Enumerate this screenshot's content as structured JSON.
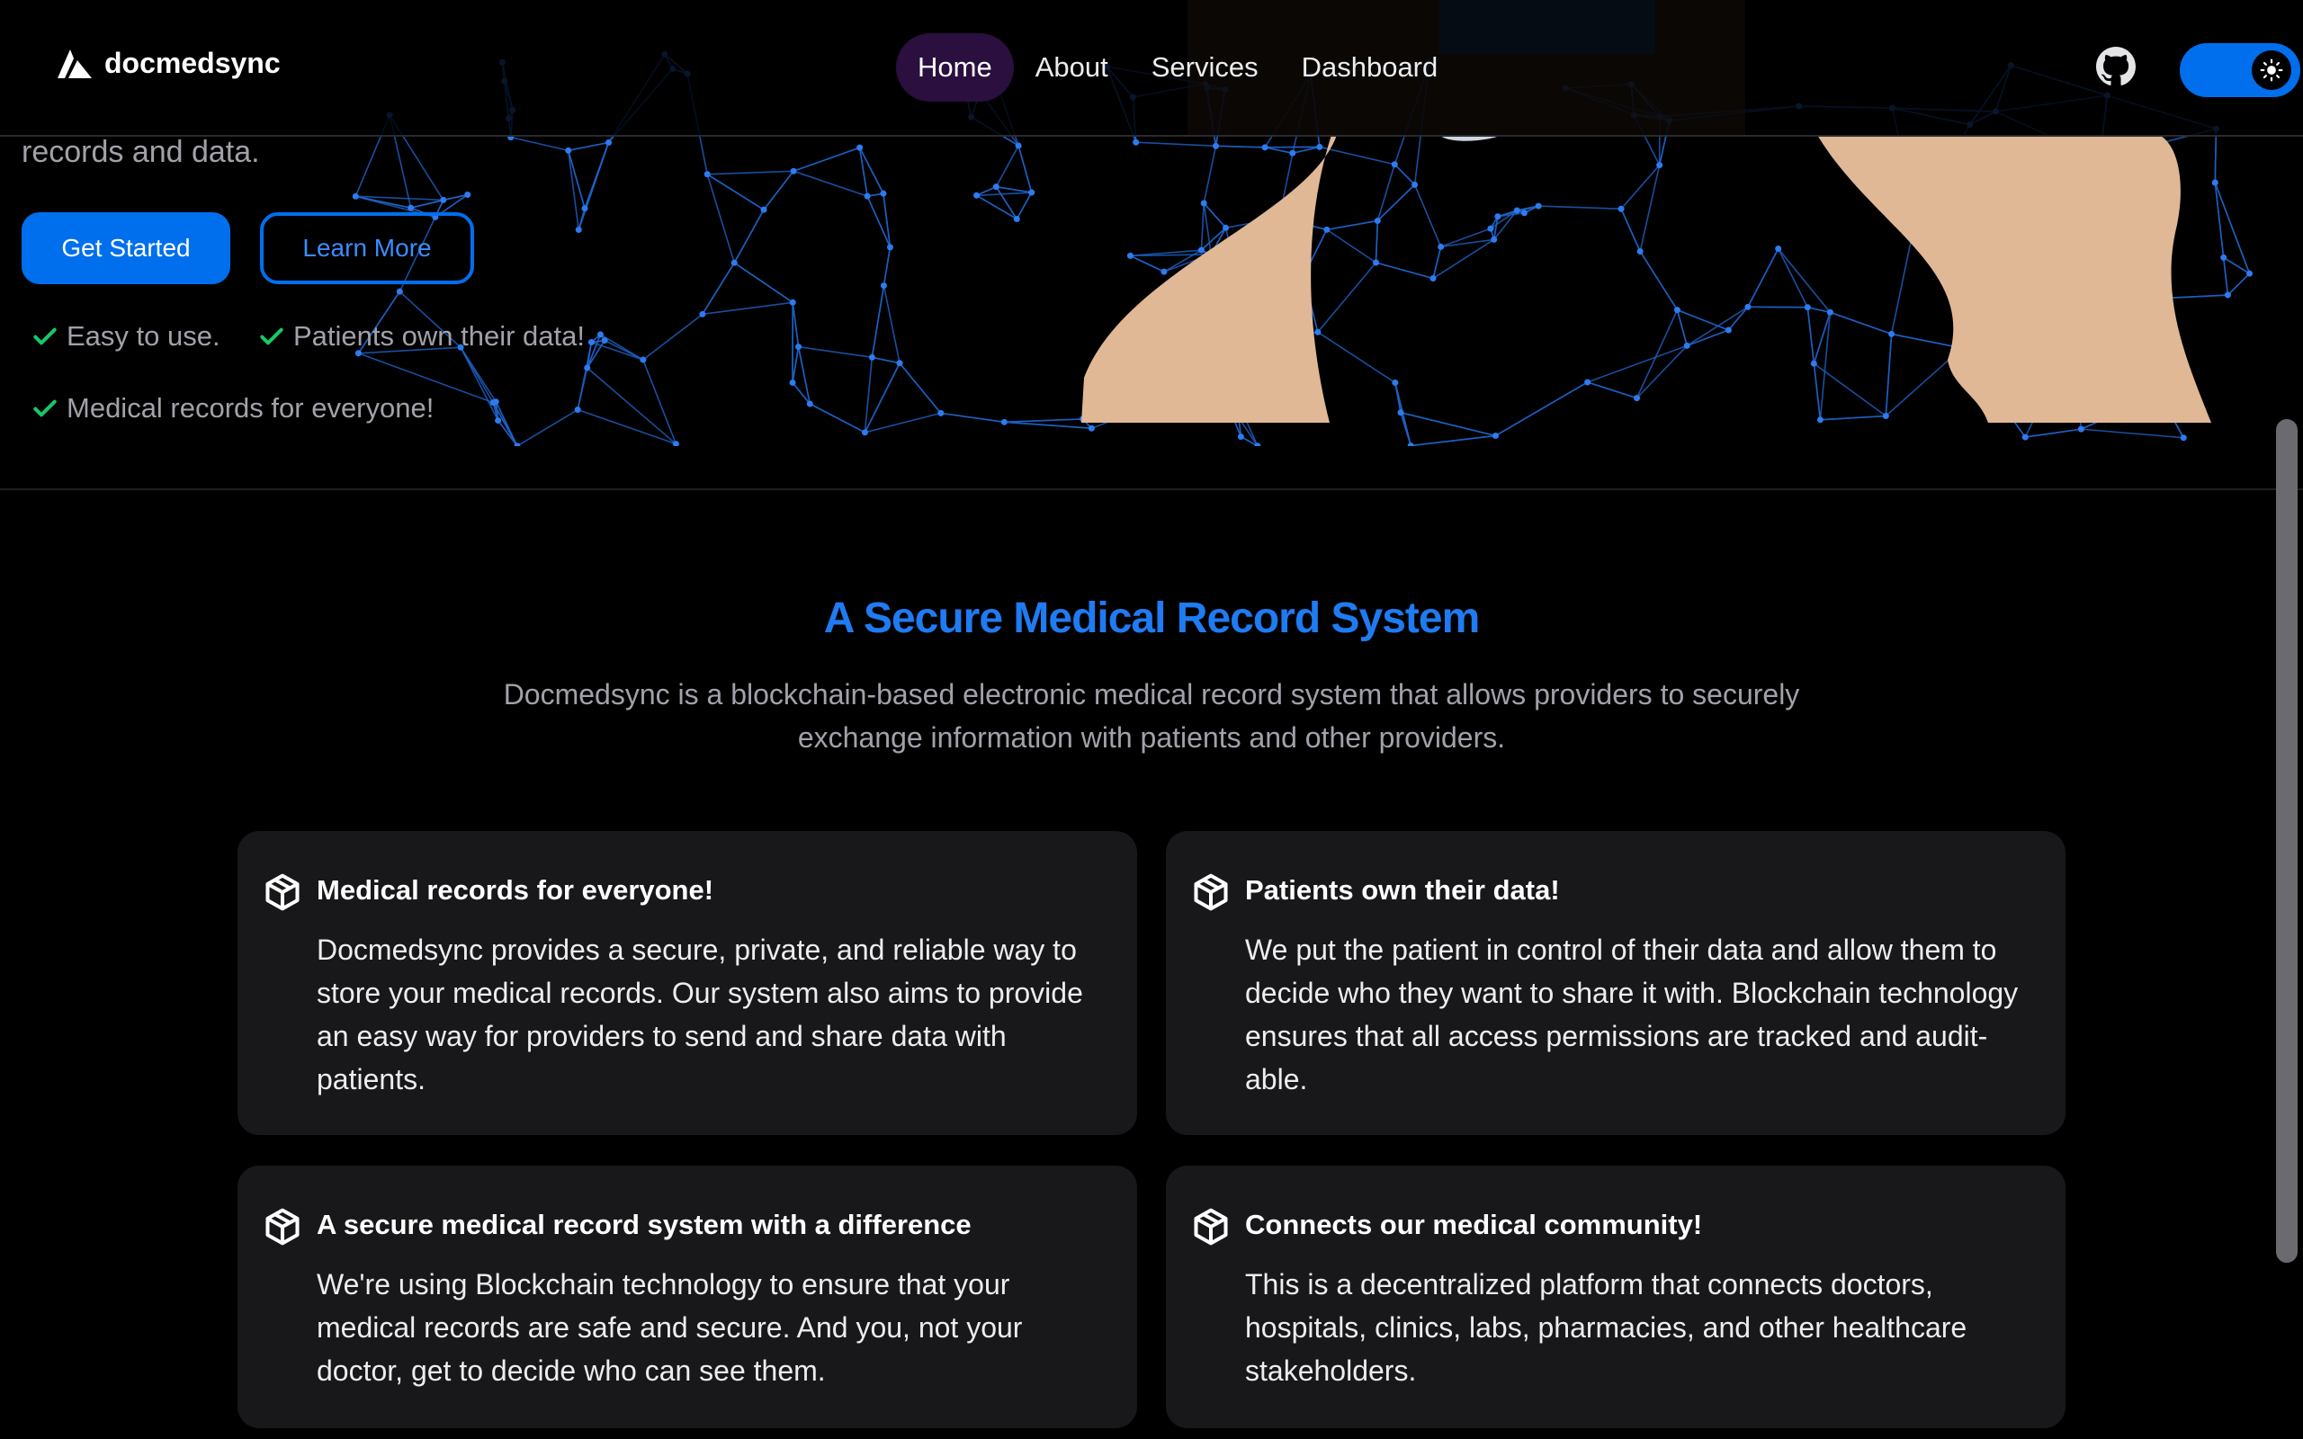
{
  "app": {
    "brand": "docmedsync"
  },
  "nav": {
    "links": [
      "Home",
      "About",
      "Services",
      "Dashboard"
    ],
    "active_link": "Home",
    "icons": {
      "github": "github-icon",
      "theme": "sun-icon"
    }
  },
  "hero": {
    "subtitle": "records and data.",
    "primary_button": "Get Started",
    "secondary_button": "Learn More",
    "checks": [
      "Easy to use.",
      "Patients own their data!",
      "Medical records for everyone!"
    ]
  },
  "section": {
    "title": "A Secure Medical Record System",
    "description": "Docmedsync is a blockchain-based electronic medical record system that allows providers to securely exchange information with patients and other providers.",
    "cards": [
      {
        "title": "Medical records for everyone!",
        "body": "Docmedsync provides a secure, private, and reliable way to store your medical records. Our system also aims to provide an easy way for providers to send and share data with patients.",
        "icon": "package-icon"
      },
      {
        "title": "Patients own their data!",
        "body": "We put the patient in control of their data and allow them to decide who they want to share it with. Blockchain technology ensures that all access permissions are tracked and audit-able.",
        "icon": "package-icon"
      },
      {
        "title": "A secure medical record system with a difference",
        "body": "We're using Blockchain technology to ensure that your medical records are safe and secure. And you, not your doctor, get to decide who can see them.",
        "icon": "package-icon"
      },
      {
        "title": "Connects our medical community!",
        "body": "This is a decentralized platform that connects doctors, hospitals, clinics, labs, pharmacies, and other healthcare stakeholders.",
        "icon": "package-icon"
      }
    ]
  },
  "colors": {
    "accent": "#006fee",
    "title_blue": "#1f7bf2",
    "check_green": "#17c964",
    "card_bg": "#18181b",
    "skin": "#e0b896"
  }
}
